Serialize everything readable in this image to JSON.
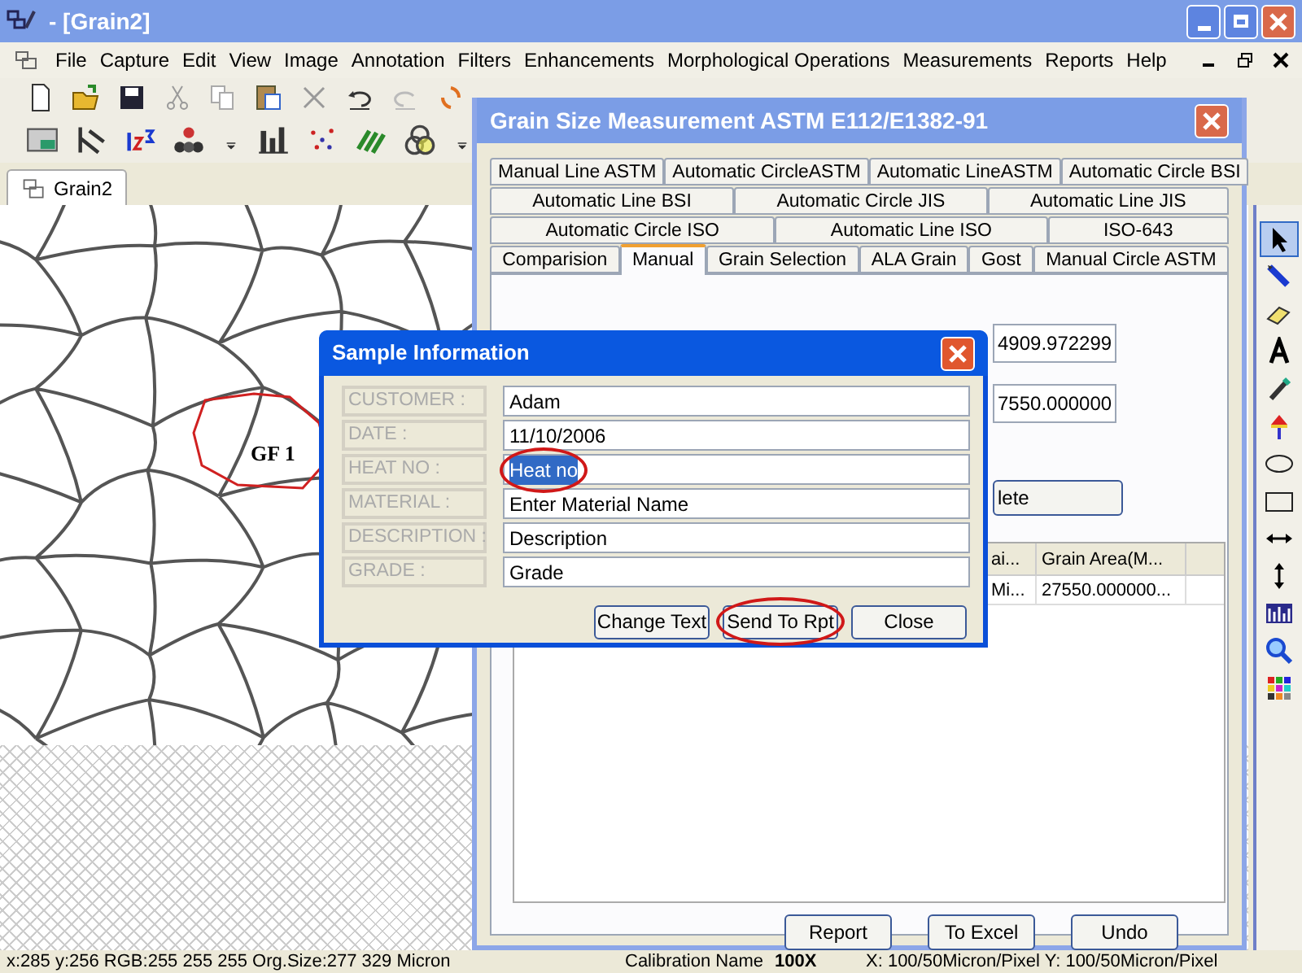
{
  "app_window": {
    "title": "- [Grain2]"
  },
  "menu": [
    "File",
    "Capture",
    "Edit",
    "View",
    "Image",
    "Annotation",
    "Filters",
    "Enhancements",
    "Morphological Operations",
    "Measurements",
    "Reports",
    "Help"
  ],
  "document_tab": {
    "label": "Grain2",
    "selected": true
  },
  "image": {
    "grain_label": "GF 1"
  },
  "tool_palette": [
    {
      "kind": "pointer",
      "selected": true
    },
    {
      "kind": "pen",
      "selected": false
    },
    {
      "kind": "eraser",
      "selected": false
    },
    {
      "kind": "text",
      "selected": false
    },
    {
      "kind": "dropper",
      "selected": false
    },
    {
      "kind": "marker",
      "selected": false
    },
    {
      "kind": "ellipse",
      "selected": false
    },
    {
      "kind": "rectangle",
      "selected": false
    },
    {
      "kind": "h-arrow",
      "selected": false
    },
    {
      "kind": "v-arrow",
      "selected": false
    },
    {
      "kind": "histogram",
      "selected": false
    },
    {
      "kind": "zoom",
      "selected": false
    },
    {
      "kind": "palette",
      "selected": false
    }
  ],
  "grain_dialog": {
    "title": "Grain Size Measurement ASTM E112/E1382-91",
    "tab_rows": [
      [
        {
          "label": "Manual Line ASTM",
          "selected": false
        },
        {
          "label": "Automatic CircleASTM",
          "selected": false
        },
        {
          "label": "Automatic LineASTM",
          "selected": false
        },
        {
          "label": "Automatic Circle BSI",
          "selected": false
        }
      ],
      [
        {
          "label": "Automatic Line BSI",
          "selected": false
        },
        {
          "label": "Automatic Circle JIS",
          "selected": false
        },
        {
          "label": "Automatic Line JIS",
          "selected": false
        }
      ],
      [
        {
          "label": "Automatic Circle ISO",
          "selected": false
        },
        {
          "label": "Automatic Line ISO",
          "selected": false
        },
        {
          "label": "ISO-643",
          "selected": false
        }
      ],
      [
        {
          "label": "Comparision",
          "selected": false
        },
        {
          "label": "Manual",
          "selected": true
        },
        {
          "label": "Grain Selection",
          "selected": false
        },
        {
          "label": "ALA Grain",
          "selected": false
        },
        {
          "label": "Gost",
          "selected": false
        },
        {
          "label": "Manual Circle ASTM",
          "selected": false
        }
      ]
    ],
    "result_fields": [
      "4909.972299",
      "7550.000000"
    ],
    "delete_button": "lete",
    "table": {
      "columns": [
        "ai...",
        "Grain Area(M..."
      ],
      "rows": [
        [
          "Mi...",
          "27550.000000..."
        ]
      ]
    },
    "buttons": [
      "Report",
      "To Excel",
      "Undo"
    ]
  },
  "sample_dialog": {
    "title": "Sample Information",
    "fields": [
      {
        "label": "CUSTOMER :",
        "value": "Adam",
        "highlighted": false
      },
      {
        "label": "DATE :",
        "value": "11/10/2006",
        "highlighted": false
      },
      {
        "label": "HEAT NO :",
        "value": "Heat no",
        "highlighted": true
      },
      {
        "label": "MATERIAL :",
        "value": "Enter Material Name",
        "highlighted": false
      },
      {
        "label": "DESCRIPTION :",
        "value": "Description",
        "highlighted": false
      },
      {
        "label": "GRADE :",
        "value": "Grade",
        "highlighted": false
      }
    ],
    "buttons": [
      {
        "label": "Change Text",
        "highlighted": false
      },
      {
        "label": "Send To Rpt",
        "highlighted": true
      },
      {
        "label": "Close",
        "highlighted": false
      }
    ]
  },
  "status_bar": {
    "coordinates": "x:285 y:256 RGB:255 255 255 Org.Size:277 329 Micron",
    "calibration_label": "Calibration Name",
    "calibration_value": "100X",
    "pixel_size": "X: 100/50Micron/Pixel Y: 100/50Micron/Pixel"
  }
}
